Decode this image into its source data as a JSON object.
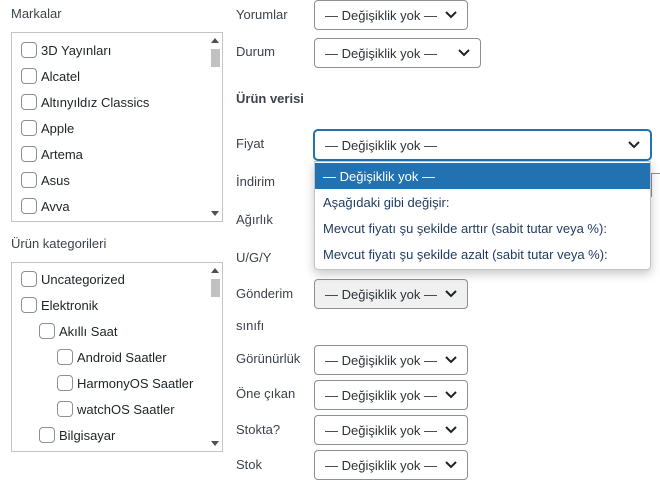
{
  "left": {
    "brands": {
      "label": "Markalar",
      "items": [
        "3D Yayınları",
        "Alcatel",
        "Altınyıldız Classics",
        "Apple",
        "Artema",
        "Asus",
        "Avva"
      ]
    },
    "categories": {
      "label": "Ürün kategorileri",
      "items": [
        {
          "label": "Uncategorized",
          "level": 0
        },
        {
          "label": "Elektronik",
          "level": 0
        },
        {
          "label": "Akıllı Saat",
          "level": 1
        },
        {
          "label": "Android Saatler",
          "level": 2
        },
        {
          "label": "HarmonyOS Saatler",
          "level": 2
        },
        {
          "label": "watchOS Saatler",
          "level": 2
        },
        {
          "label": "Bilgisayar",
          "level": 1
        }
      ]
    }
  },
  "fields": {
    "comments": {
      "label": "Yorumlar",
      "value": "— Değişiklik yok —"
    },
    "status": {
      "label": "Durum",
      "value": "— Değişiklik yok —"
    },
    "product_data_heading": "Ürün verisi",
    "price": {
      "label": "Fiyat",
      "value": "— Değişiklik yok —"
    },
    "sale": {
      "label": "İndirim"
    },
    "weight": {
      "label": "Ağırlık"
    },
    "dimensions": {
      "label": "U/G/Y"
    },
    "shipping_class": {
      "label_line1": "Gönderim",
      "label_line2": "sınıfı",
      "value": "— Değişiklik yok —"
    },
    "visibility": {
      "label": "Görünürlük",
      "value": "— Değişiklik yok —"
    },
    "featured": {
      "label": "Öne çıkan",
      "value": "— Değişiklik yok —"
    },
    "in_stock": {
      "label": "Stokta?",
      "value": "— Değişiklik yok —"
    },
    "stock": {
      "label": "Stok",
      "value": "— Değişiklik yok —"
    }
  },
  "price_dropdown": {
    "options": [
      "— Değişiklik yok —",
      "Aşağıdaki gibi değişir:",
      "Mevcut fiyatı şu şekilde arttır (sabit tutar veya %):",
      "Mevcut fiyatı şu şekilde azalt (sabit tutar veya %):"
    ],
    "selected_index": 0
  },
  "colors": {
    "accent": "#2271b1",
    "border": "#8c8f94"
  }
}
